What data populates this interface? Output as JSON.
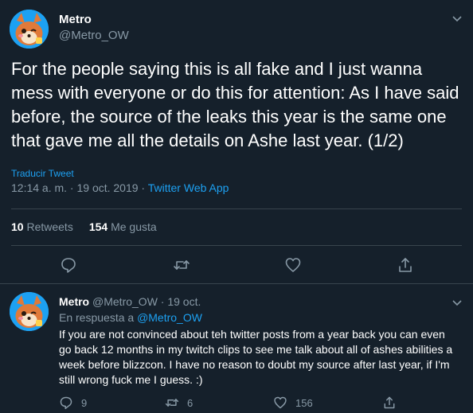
{
  "colors": {
    "background": "#15202b",
    "text_primary": "#ffffff",
    "text_secondary": "#8899a6",
    "accent": "#1da1f2",
    "divider": "#38444d"
  },
  "main_tweet": {
    "display_name": "Metro",
    "handle": "@Metro_OW",
    "text": "For the people saying this is all fake and I just wanna mess with everyone or do this for attention: As I have said before, the source of the leaks this year is the same one that gave me all the details on Ashe last year. (1/2)",
    "translate_label": "Traducir Tweet",
    "timestamp": "12:14 a. m. · 19 oct. 2019 · ",
    "source": "Twitter Web App",
    "retweet_count": "10",
    "retweet_label": " Retweets",
    "like_count": "154",
    "like_label": " Me gusta",
    "icons": {
      "menu": "chevron-down-icon",
      "reply": "reply-icon",
      "retweet": "retweet-icon",
      "like": "heart-icon",
      "share": "share-icon"
    }
  },
  "reply_tweet": {
    "display_name": "Metro",
    "handle": "@Metro_OW",
    "date": " · 19 oct.",
    "reply_to_prefix": "En respuesta a ",
    "reply_to_handle": "@Metro_OW",
    "text": "If you are not convinced about teh twitter posts from a year back you can even go back 12 months in my twitch clips to see me talk about all of ashes abilities a week before blizzcon. I have no reason to doubt my source after last year, if I'm still wrong fuck me I guess. :)",
    "reply_count": "9",
    "retweet_count": "6",
    "like_count": "156"
  }
}
